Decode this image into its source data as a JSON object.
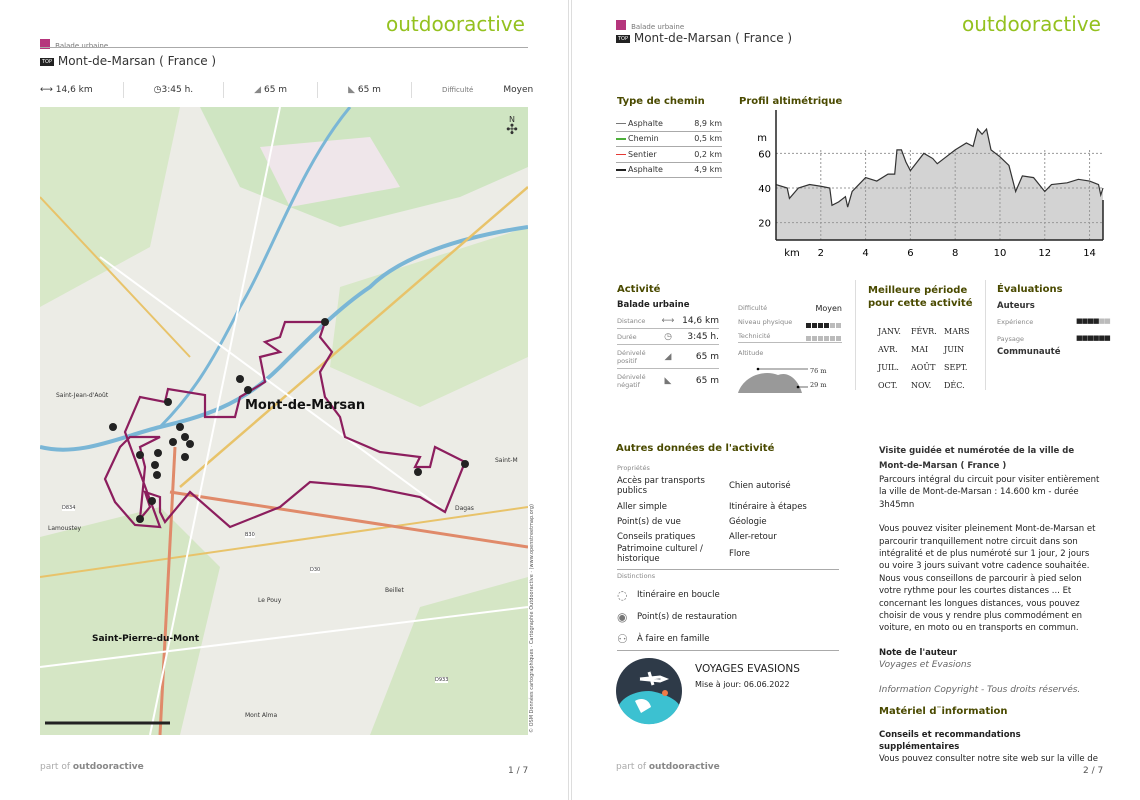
{
  "brand": "outdooractive",
  "category": "Balade urbaine",
  "badge": "TOP",
  "title": "Mont-de-Marsan ( France )",
  "stats": {
    "distance": "14,6 km",
    "duration": "3:45 h.",
    "ascent": "65 m",
    "descent": "65 m",
    "difficulty_label": "Difficulté",
    "difficulty": "Moyen"
  },
  "map": {
    "town": "Mont-de-Marsan",
    "town2": "Saint-Pierre-du-Mont",
    "places": [
      "Saint-Jean-d'Août",
      "Dagas",
      "Le Pouy",
      "Beillet",
      "Mont Alma",
      "Lamoustey",
      "Saint-M"
    ],
    "roads": [
      "D834",
      "D30",
      "D933",
      "B30"
    ],
    "copyright": "© OSM Données cartographiques · Cartographie Outdooractive · (www.openstreetmap.org)",
    "north": "N"
  },
  "path_types": {
    "heading": "Type de chemin",
    "items": [
      {
        "label": "Asphalte",
        "value": "8,9 km",
        "color": "#777777"
      },
      {
        "label": "Chemin",
        "value": "0,5 km",
        "color": "#4caf3a"
      },
      {
        "label": "Sentier",
        "value": "0,2 km",
        "color": "#e53935"
      },
      {
        "label": "Asphalte",
        "value": "4,9 km",
        "color": "#222222"
      }
    ]
  },
  "chart_data": {
    "type": "area",
    "title": "Profil altimétrique",
    "xlabel": "km",
    "ylabel": "m",
    "xlim": [
      0,
      14.6
    ],
    "ylim": [
      10,
      85
    ],
    "xticks": [
      2,
      4,
      6,
      8,
      10,
      12,
      14
    ],
    "yticks": [
      20,
      40,
      60
    ],
    "grid": true,
    "x": [
      0,
      0.5,
      0.6,
      1,
      1.5,
      2,
      2.4,
      2.5,
      2.8,
      3.1,
      3.2,
      3.4,
      4,
      4.5,
      5,
      5.3,
      5.4,
      5.6,
      5.8,
      6,
      6.3,
      6.6,
      7,
      7.2,
      7.6,
      8,
      8.5,
      8.8,
      9,
      9.2,
      9.4,
      9.6,
      10,
      10.4,
      10.7,
      11,
      11.5,
      12,
      12.3,
      13,
      13.5,
      14,
      14.4,
      14.5,
      14.6
    ],
    "y": [
      42,
      40,
      34,
      40,
      42,
      41,
      40,
      30,
      32,
      35,
      29,
      38,
      46,
      44,
      48,
      48,
      62,
      62,
      55,
      50,
      55,
      60,
      57,
      54,
      58,
      62,
      66,
      64,
      74,
      71,
      74,
      62,
      58,
      53,
      38,
      47,
      46,
      38,
      42,
      43,
      45,
      44,
      42,
      36,
      40
    ]
  },
  "activity": {
    "heading": "Activité",
    "type": "Balade urbaine",
    "rows": [
      {
        "label": "Distance",
        "value": "14,6 km",
        "icon": "arrows-icon"
      },
      {
        "label": "Durée",
        "value": "3:45 h.",
        "icon": "clock-icon"
      },
      {
        "label": "Dénivelé positif",
        "value": "65 m",
        "icon": "ascent-icon"
      },
      {
        "label": "Dénivelé négatif",
        "value": "65 m",
        "icon": "descent-icon"
      }
    ],
    "difficulty_label": "Difficulté",
    "difficulty": "Moyen",
    "physical_label": "Niveau physique",
    "physical_level": 4,
    "technique_label": "Technicité",
    "technique_level": 0,
    "altitude_label": "Altitude",
    "alt_max": "76 m",
    "alt_min": "29 m"
  },
  "season": {
    "heading1": "Meilleure période",
    "heading2": "pour cette activité",
    "months": [
      "JANV.",
      "FÉVR.",
      "MARS",
      "AVR.",
      "MAI",
      "JUIN",
      "JUIL.",
      "AOÛT",
      "SEPT.",
      "OCT.",
      "NOV.",
      "DÉC."
    ]
  },
  "ratings": {
    "heading": "Évaluations",
    "authors": "Auteurs",
    "experience": "Expérience",
    "experience_level": 4,
    "landscape": "Paysage",
    "landscape_level": 6,
    "community": "Communauté"
  },
  "other": {
    "heading": "Autres données de l'activité",
    "props_label": "Propriétés",
    "props": [
      [
        "Accès par transports publics",
        "Chien autorisé"
      ],
      [
        "Aller simple",
        "Itinéraire à étapes"
      ],
      [
        "Point(s) de vue",
        "Géologie"
      ],
      [
        "Conseils pratiques",
        "Aller-retour"
      ],
      [
        "Patrimoine culturel / historique",
        "Flore"
      ]
    ],
    "dist_label": "Distinctions",
    "distinctions": [
      "Itinéraire en boucle",
      "Point(s) de restauration",
      "À faire en famille"
    ]
  },
  "author": {
    "name": "VOYAGES EVASIONS",
    "updated": "Mise à jour: 06.06.2022"
  },
  "description": {
    "lead": "Visite guidée et numérotée de la ville de Mont-de-Marsan ( France )",
    "p1": "Parcours intégral du circuit pour visiter entièrement la ville de Mont-de-Marsan : 14.600 km - durée 3h45mn",
    "p2": "Vous pouvez visiter pleinement Mont-de-Marsan et parcourir tranquillement notre circuit dans son intégralité et de plus numéroté sur 1 jour, 2 jours ou voire 3 jours suivant votre cadence souhaitée. Nous vous conseillons de parcourir à pied selon votre rythme pour les courtes distances ... Et concernant les longues distances, vous pouvez choisir de vous y rendre plus commodément en voiture, en moto ou en transports en commun.",
    "note_heading": "Note de l'auteur",
    "note": "Voyages et Evasions",
    "copyright": "Information Copyright - Tous droits réservés.",
    "material_heading": "Matériel d¨information",
    "tips_heading": "Conseils et recommandations supplémentaires",
    "tips": "Vous pouvez consulter notre site web sur la ville de"
  },
  "footer": {
    "part_of": "part of",
    "brand": "outdooractive",
    "page1": "1 / 7",
    "page2": "2 / 7"
  }
}
